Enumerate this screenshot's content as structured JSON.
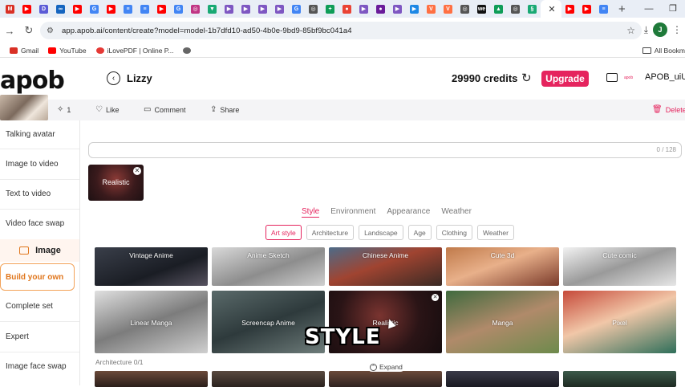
{
  "browser": {
    "tab_favicons": [
      {
        "icon": "gmail-icon",
        "color": "#d93025",
        "glyph": "M"
      },
      {
        "icon": "youtube-icon",
        "color": "#ff0000",
        "glyph": "▶"
      },
      {
        "icon": "app-icon",
        "color": "#5b5bd6",
        "glyph": "D"
      },
      {
        "icon": "loop-icon",
        "color": "#1565c0",
        "glyph": "∞"
      },
      {
        "icon": "youtube-icon",
        "color": "#ff0000",
        "glyph": "▶"
      },
      {
        "icon": "google-icon",
        "color": "#4285f4",
        "glyph": "G"
      },
      {
        "icon": "youtube-icon",
        "color": "#ff0000",
        "glyph": "▶"
      },
      {
        "icon": "docs-icon",
        "color": "#4285f4",
        "glyph": "≡"
      },
      {
        "icon": "docs-icon",
        "color": "#4285f4",
        "glyph": "≡"
      },
      {
        "icon": "youtube-icon",
        "color": "#ff0000",
        "glyph": "▶"
      },
      {
        "icon": "google-icon",
        "color": "#4285f4",
        "glyph": "G"
      },
      {
        "icon": "instagram-icon",
        "color": "#c13584",
        "glyph": "◎"
      },
      {
        "icon": "app-icon",
        "color": "#19a974",
        "glyph": "▼"
      },
      {
        "icon": "play-icon",
        "color": "#7e57c2",
        "glyph": "▶"
      },
      {
        "icon": "play-icon",
        "color": "#7e57c2",
        "glyph": "▶"
      },
      {
        "icon": "play-icon",
        "color": "#7e57c2",
        "glyph": "▶"
      },
      {
        "icon": "play-icon",
        "color": "#7e57c2",
        "glyph": "▶"
      },
      {
        "icon": "google-icon",
        "color": "#4285f4",
        "glyph": "G"
      },
      {
        "icon": "globe-icon",
        "color": "#555555",
        "glyph": "◎"
      },
      {
        "icon": "sheets-icon",
        "color": "#0f9d58",
        "glyph": "+"
      },
      {
        "icon": "maps-icon",
        "color": "#ea4335",
        "glyph": "●"
      },
      {
        "icon": "play-icon",
        "color": "#7e57c2",
        "glyph": "▶"
      },
      {
        "icon": "app-icon",
        "color": "#6a1b9a",
        "glyph": "●"
      },
      {
        "icon": "play-icon",
        "color": "#7e57c2",
        "glyph": "▶"
      },
      {
        "icon": "app-icon",
        "color": "#1e88e5",
        "glyph": "▶"
      },
      {
        "icon": "app-icon",
        "color": "#ff7043",
        "glyph": "V"
      },
      {
        "icon": "app-icon",
        "color": "#ff7043",
        "glyph": "V"
      },
      {
        "icon": "globe-icon",
        "color": "#555555",
        "glyph": "◎"
      },
      {
        "icon": "app-icon",
        "color": "#111111",
        "glyph": "we"
      },
      {
        "icon": "drive-icon",
        "color": "#0f9d58",
        "glyph": "▲"
      },
      {
        "icon": "globe-icon",
        "color": "#555555",
        "glyph": "◎"
      },
      {
        "icon": "app-icon",
        "color": "#19a974",
        "glyph": "§"
      }
    ],
    "tab_favicons_after": [
      {
        "icon": "youtube-icon",
        "color": "#ff0000",
        "glyph": "▶"
      },
      {
        "icon": "youtube-icon",
        "color": "#ff0000",
        "glyph": "▶"
      },
      {
        "icon": "docs-icon",
        "color": "#4285f4",
        "glyph": "≡"
      }
    ],
    "active_tab_close": "✕",
    "new_tab": "+",
    "window_controls": [
      "—",
      "❐"
    ],
    "url": "app.apob.ai/content/create?model=model-1b7dfd10-ad50-4b0e-9bd9-85bf9bc041a4",
    "profile_initial": "J",
    "bookmarks": [
      {
        "label": "Gmail",
        "color": "#d93025"
      },
      {
        "label": "YouTube",
        "color": "#ff0000"
      },
      {
        "label": "iLovePDF | Online P...",
        "color": "#e53935"
      },
      {
        "label": "",
        "color": "#666666"
      }
    ],
    "all_bookmarks": "All Bookm"
  },
  "header": {
    "logo": "apob",
    "model_name": "Lizzy",
    "credits": "29990 credits",
    "upgrade_label": "Upgrade",
    "mini_brand": "apob",
    "user": "APOB_uiU"
  },
  "toolbar": {
    "count": "1",
    "like": "Like",
    "comment": "Comment",
    "share": "Share",
    "delete": "Delete"
  },
  "sidebar": {
    "items_top": [
      "Talking avatar",
      "Image to video",
      "Text to video",
      "Video face swap"
    ],
    "category": "Image",
    "active": "Build your own",
    "items_bottom": [
      "Complete set",
      "Expert",
      "Image face swap"
    ]
  },
  "main": {
    "prompt_count": "0 / 128",
    "selected_chip": "Realistic",
    "categories": [
      {
        "label": "Style",
        "active": true
      },
      {
        "label": "Environment",
        "active": false
      },
      {
        "label": "Appearance",
        "active": false
      },
      {
        "label": "Weather",
        "active": false
      }
    ],
    "subcategories": [
      {
        "label": "Art style",
        "active": true
      },
      {
        "label": "Architecture",
        "active": false
      },
      {
        "label": "Landscape",
        "active": false
      },
      {
        "label": "Age",
        "active": false
      },
      {
        "label": "Clothing",
        "active": false
      },
      {
        "label": "Weather",
        "active": false
      }
    ],
    "styles_row1": [
      "Vintage Anime",
      "Anime Sketch",
      "Chinese Anime",
      "Cute 3d",
      "Cute comic"
    ],
    "styles_row2": [
      "Linear Manga",
      "Screencap Anime",
      "Realistic",
      "Manga",
      "Pixel"
    ],
    "section_label": "Architecture  0/1",
    "expand_label": "Expand",
    "caption": "STYLE"
  },
  "colors": {
    "accent_pink": "#e5245e",
    "accent_orange": "#e0761c"
  }
}
